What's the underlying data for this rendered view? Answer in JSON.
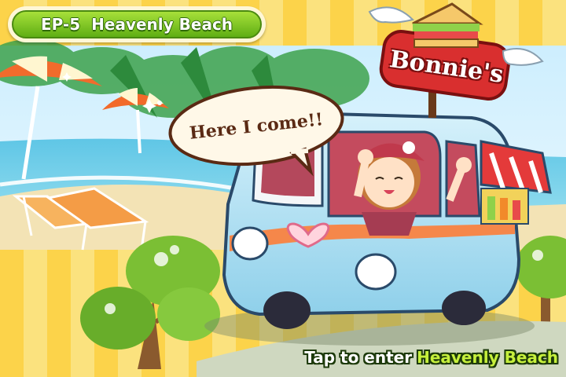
{
  "episode": {
    "number_label": "EP-5",
    "title": "Heavenly Beach"
  },
  "speech_bubble": "Here I come!!",
  "truck_sign": "Bonnie's",
  "prompt": {
    "prefix": "Tap to enter",
    "destination": "Heavenly Beach"
  },
  "colors": {
    "badge_green": "#7cc321",
    "prompt_green": "#c6f03c",
    "stripe_yellow": "#fcd34a",
    "truck_blue": "#a8dff2",
    "truck_orange": "#f5874a",
    "sign_red": "#d92f2f"
  }
}
